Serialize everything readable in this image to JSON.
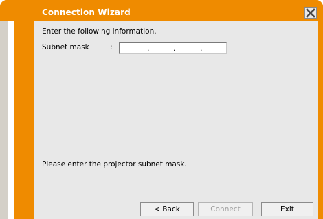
{
  "window": {
    "title": "Connection Wizard",
    "close_icon": "close-icon"
  },
  "form": {
    "instruction": "Enter the following information.",
    "subnet_label": "Subnet mask",
    "colon": ":",
    "subnet_value": "",
    "separators": [
      ".",
      ".",
      "."
    ],
    "hint": "Please enter the projector subnet mask."
  },
  "buttons": {
    "back": "< Back",
    "connect": "Connect",
    "connect_enabled": false,
    "exit": "Exit"
  },
  "colors": {
    "accent": "#ef8b00",
    "panel": "#e8e8e8",
    "left_band_light": "#d4d0c8"
  }
}
